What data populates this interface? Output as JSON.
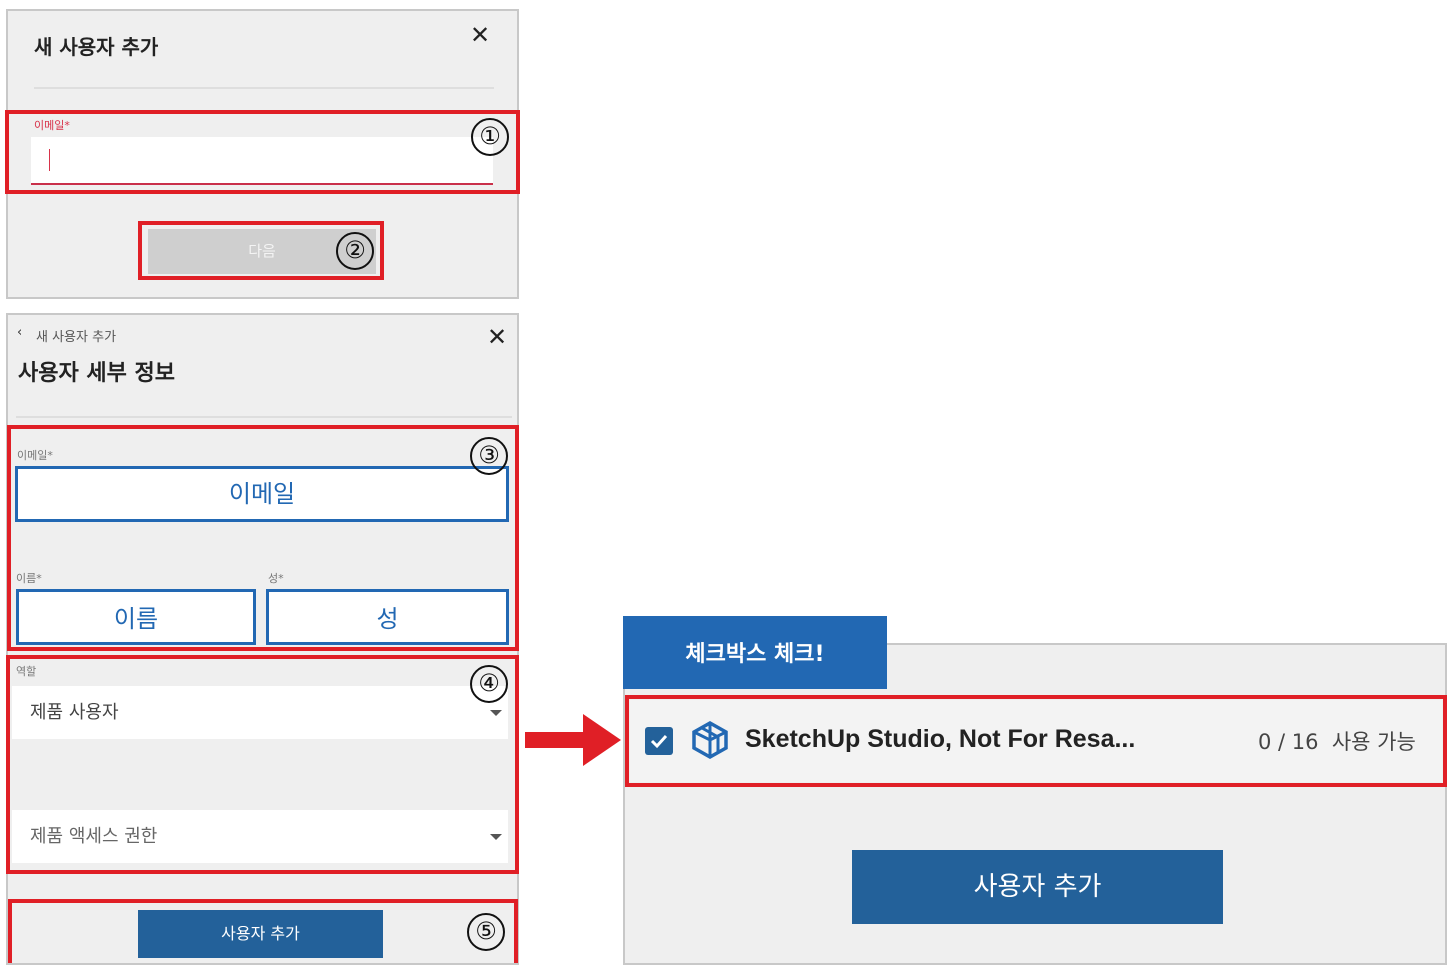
{
  "step1": {
    "title": "새 사용자 추가",
    "email_label": "이메일*",
    "email_value": "",
    "next_button": "다음",
    "marker_email": "①",
    "marker_next": "②"
  },
  "step2": {
    "breadcrumb": "새 사용자 추가",
    "title": "사용자 세부 정보",
    "email_label": "이메일*",
    "email_value": "이메일",
    "first_name_label": "이름*",
    "first_name_value": "이름",
    "last_name_label": "성*",
    "last_name_value": "성",
    "role_label": "역할",
    "role_value": "제품 사용자",
    "access_value": "제품 액세스 권한",
    "add_button": "사용자 추가",
    "marker_fields": "③",
    "marker_roles": "④",
    "marker_add": "⑤"
  },
  "step3": {
    "tab_label": "체크박스 체크!",
    "product_name": "SketchUp Studio, Not For Resa...",
    "availability": "0 / 16  사용 가능",
    "checked": true,
    "add_button": "사용자 추가"
  },
  "colors": {
    "red": "#e01f26",
    "blue": "#2268b3",
    "dark_blue": "#23619a",
    "panel_bg": "#efefef"
  },
  "icons": {
    "close": "close-icon",
    "back": "chevron-left-icon",
    "checkbox": "checkbox-checked-icon",
    "product": "sketchup-logo-icon",
    "dropdown": "caret-down-icon",
    "arrow": "arrow-right-icon"
  }
}
